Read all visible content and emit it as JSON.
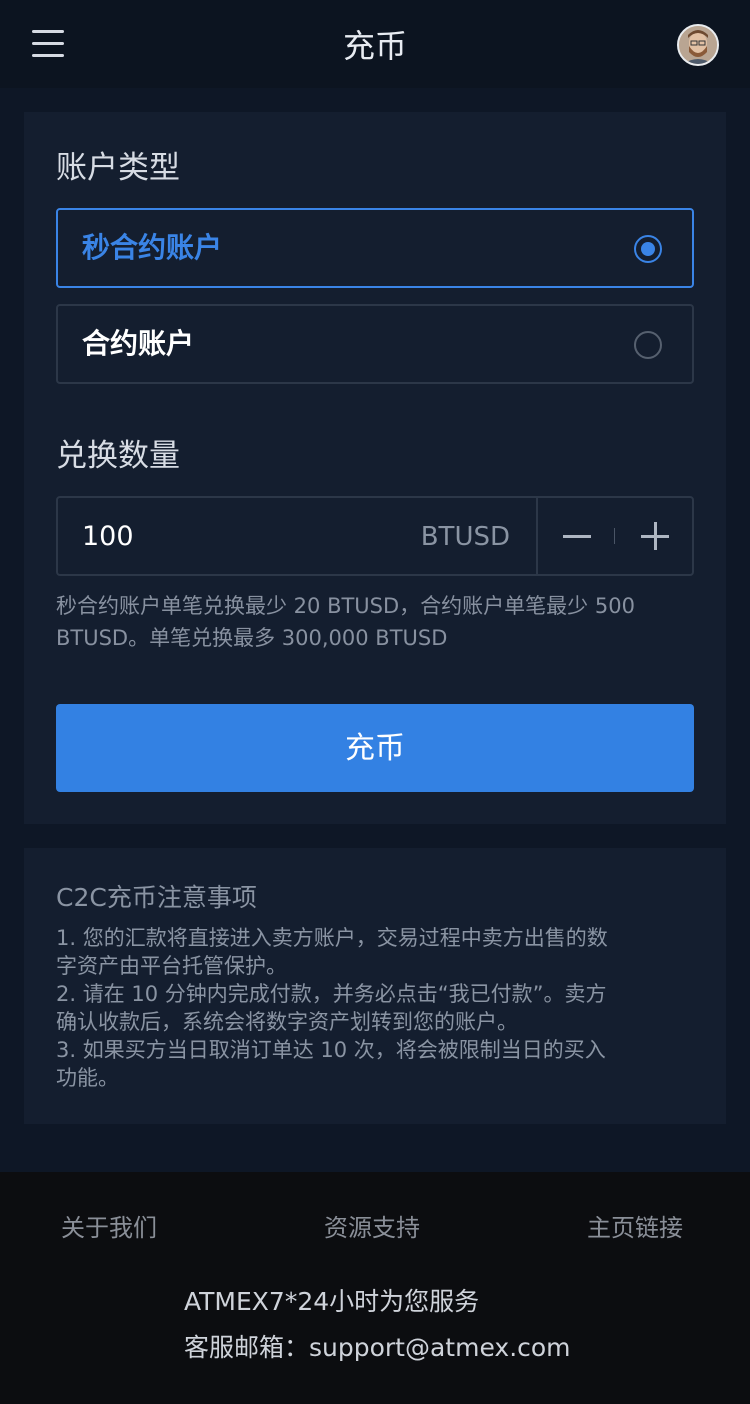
{
  "header": {
    "title": "充币",
    "menu_icon": "hamburger-menu-icon",
    "avatar_icon": "user-avatar-icon"
  },
  "form": {
    "account_type_label": "账户类型",
    "options": [
      {
        "label": "秒合约账户",
        "selected": true
      },
      {
        "label": "合约账户",
        "selected": false
      }
    ],
    "amount_label": "兑换数量",
    "amount_value": "100",
    "amount_unit": "BTUSD",
    "hint": "秒合约账户单笔兑换最少 20 BTUSD，合约账户单笔最少 500 BTUSD。单笔兑换最多 300,000 BTUSD",
    "submit_label": "充币"
  },
  "notes": {
    "title": "C2C充币注意事项",
    "items": [
      "1. 您的汇款将直接进入卖方账户，交易过程中卖方出售的数",
      "字资产由平台托管保护。",
      "2. 请在 10 分钟内完成付款，并务必点击“我已付款”。卖方",
      "确认收款后，系统会将数字资产划转到您的账户。",
      "3. 如果买方当日取消订单达 10 次，将会被限制当日的买入",
      "功能。"
    ]
  },
  "footer": {
    "links": [
      "关于我们",
      "资源支持",
      "主页链接"
    ],
    "service": "ATMEX7*24小时为您服务",
    "email": "客服邮箱：support@atmex.com"
  },
  "colors": {
    "accent": "#3381e3",
    "background": "#0e1726",
    "panel": "#141e2f"
  }
}
